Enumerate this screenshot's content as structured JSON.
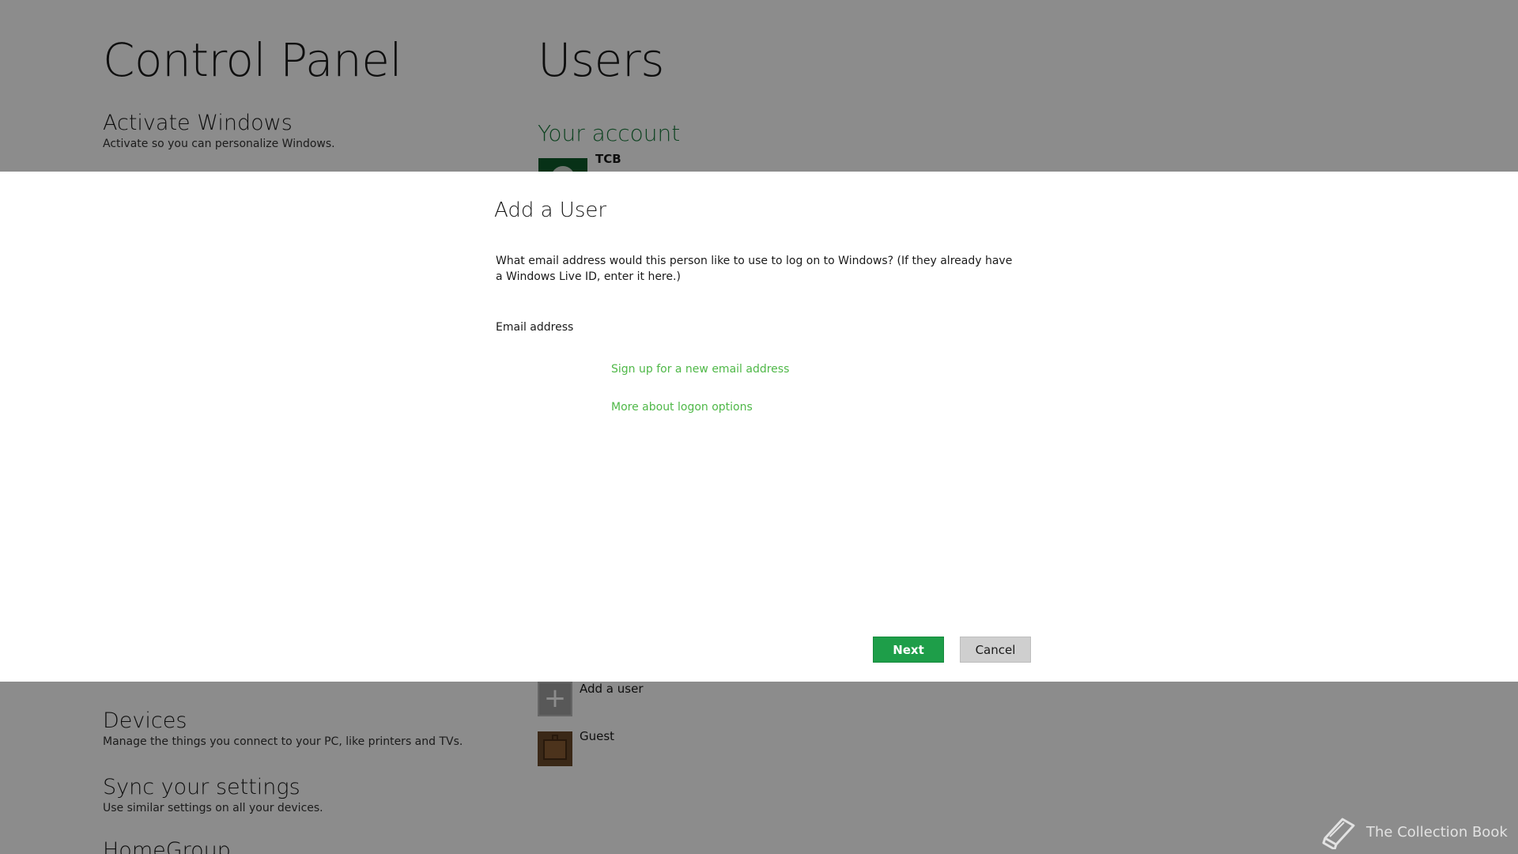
{
  "background": {
    "left_title": "Control Panel",
    "right_title": "Users",
    "left_items": [
      {
        "heading": "Activate Windows",
        "description": "Activate so you can personalize Windows."
      },
      {
        "heading": "Devices",
        "description": "Manage the things you connect to your PC, like printers and TVs."
      },
      {
        "heading": "Sync your settings",
        "description": "Use similar settings on all your devices."
      },
      {
        "heading": "HomeGroup",
        "description": ""
      }
    ],
    "account_heading": "Your account",
    "account_name": "TCB",
    "add_user_label": "Add a user",
    "guest_label": "Guest"
  },
  "dialog": {
    "title": "Add a User",
    "prompt": "What email address would this person like to use to log on to Windows? (If they already have a Windows Live ID, enter it here.)",
    "email_label": "Email address",
    "email_value": "",
    "signup_link": "Sign up for a new email address",
    "logon_link": "More about logon options",
    "next_label": "Next",
    "cancel_label": "Cancel"
  },
  "watermark": {
    "text": "The Collection Book"
  },
  "colors": {
    "accent_green": "#1e9e49",
    "link_green": "#4fb848",
    "heading_green": "#1a7a3c"
  }
}
